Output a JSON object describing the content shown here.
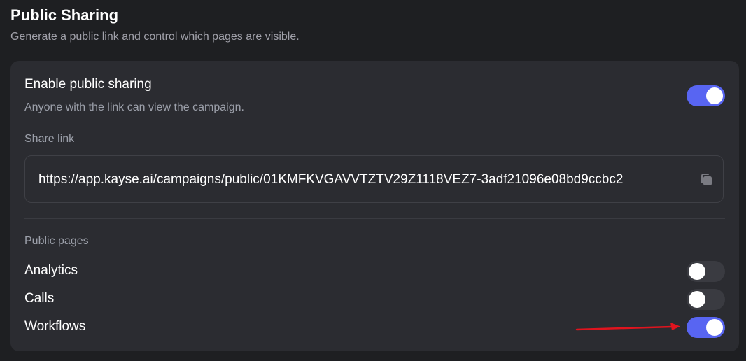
{
  "section": {
    "title": "Public Sharing",
    "description": "Generate a public link and control which pages are visible."
  },
  "enable_sharing": {
    "title": "Enable public sharing",
    "description": "Anyone with the link can view the campaign.",
    "enabled": true
  },
  "share_link": {
    "label": "Share link",
    "url": "https://app.kayse.ai/campaigns/public/01KMFKVGAVVTZTV29Z1118VEZ7-3adf21096e08bd9ccbc2",
    "copy_icon": "copy-icon"
  },
  "public_pages": {
    "label": "Public pages",
    "items": [
      {
        "label": "Analytics",
        "enabled": false
      },
      {
        "label": "Calls",
        "enabled": false
      },
      {
        "label": "Workflows",
        "enabled": true
      }
    ]
  },
  "colors": {
    "toggle_on": "#5865f2",
    "toggle_off": "#3a3b41",
    "annotation_arrow": "#e0141e"
  }
}
